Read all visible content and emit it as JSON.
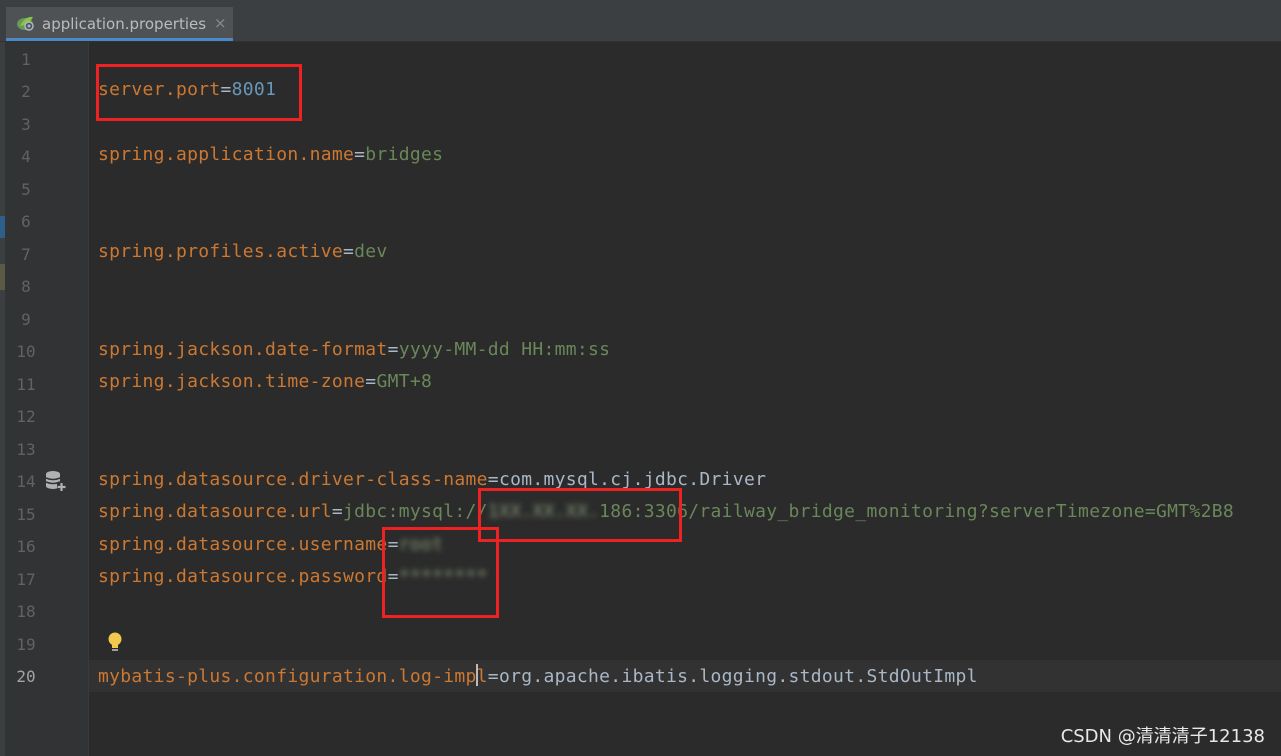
{
  "tab": {
    "label": "application.properties",
    "close": "×"
  },
  "gutter": {
    "lines": [
      "1",
      "2",
      "3",
      "4",
      "5",
      "6",
      "7",
      "8",
      "9",
      "10",
      "11",
      "12",
      "13",
      "14",
      "15",
      "16",
      "17",
      "18",
      "19",
      "20"
    ]
  },
  "editor": {
    "l2": {
      "key": "server.port",
      "eq": "=",
      "value": "8001"
    },
    "l4": {
      "key": "spring.application.name",
      "eq": "=",
      "value": "bridges"
    },
    "l7": {
      "key": "spring.profiles.active",
      "eq": "=",
      "value": "dev"
    },
    "l10": {
      "key": "spring.jackson.date-format",
      "eq": "=",
      "value": "yyyy-MM-dd HH:mm:ss"
    },
    "l11": {
      "key": "spring.jackson.time-zone",
      "eq": "=",
      "value": "GMT+8"
    },
    "l14": {
      "key": "spring.datasource.driver-class-name",
      "eq": "=",
      "value": "com.mysql.cj.jdbc.Driver"
    },
    "l15": {
      "key": "spring.datasource.url",
      "eq": "=",
      "value_prefix": "jdbc:mysql://",
      "value_masked": "1XX.XX.XX.",
      "value_suffix": "186:3306/railway_bridge_monitoring?serverTimezone=GMT%2B8"
    },
    "l16": {
      "key": "spring.datasource.username",
      "eq": "=",
      "value_masked": "root"
    },
    "l17": {
      "key": "spring.datasource.password",
      "eq": "=",
      "value_masked": "********"
    },
    "l20": {
      "key_a": "mybatis-plus.configuration.log-imp",
      "key_b": "l",
      "eq": "=",
      "value": "org.apache.ibatis.logging.stdout.StdOutImpl"
    }
  },
  "icons": {
    "tab": "spring-properties-icon",
    "gutter_14": "database-add-icon",
    "gutter_19": "lightbulb-icon"
  },
  "colors": {
    "background": "#2b2b2b",
    "key": "#cc7832",
    "value": "#6a8759",
    "number": "#6897bb",
    "annotation": "#ee2222"
  },
  "watermark": "CSDN @清清清子12138"
}
